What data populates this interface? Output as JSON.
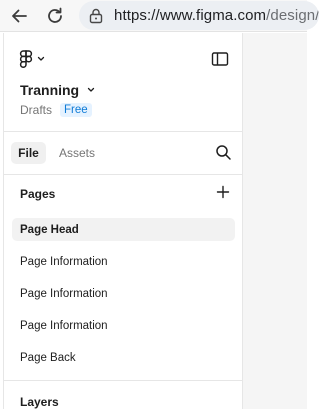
{
  "browser": {
    "url_host": "https://www.figma.com",
    "url_path": "/design/"
  },
  "sidebar": {
    "file_title": "Tranning",
    "location": "Drafts",
    "plan_badge": "Free",
    "tabs": [
      {
        "label": "File",
        "active": true
      },
      {
        "label": "Assets",
        "active": false
      }
    ],
    "pages_title": "Pages",
    "pages": [
      {
        "label": "Page Head",
        "selected": true
      },
      {
        "label": "Page Information",
        "selected": false
      },
      {
        "label": "Page Information",
        "selected": false
      },
      {
        "label": "Page Information",
        "selected": false
      },
      {
        "label": "Page Back",
        "selected": false
      }
    ],
    "layers_title": "Layers"
  },
  "colors": {
    "accent": "#0d7ad6",
    "badge_bg": "#e5f2ff",
    "selected_bg": "#f2f2f2"
  },
  "icons": {
    "back": "arrow-left-icon",
    "reload": "reload-icon",
    "site_info": "site-info-icon",
    "figma_logo": "figma-logo-icon",
    "panel_toggle": "sidebar-toggle-icon",
    "search": "search-icon",
    "add": "plus-icon"
  }
}
